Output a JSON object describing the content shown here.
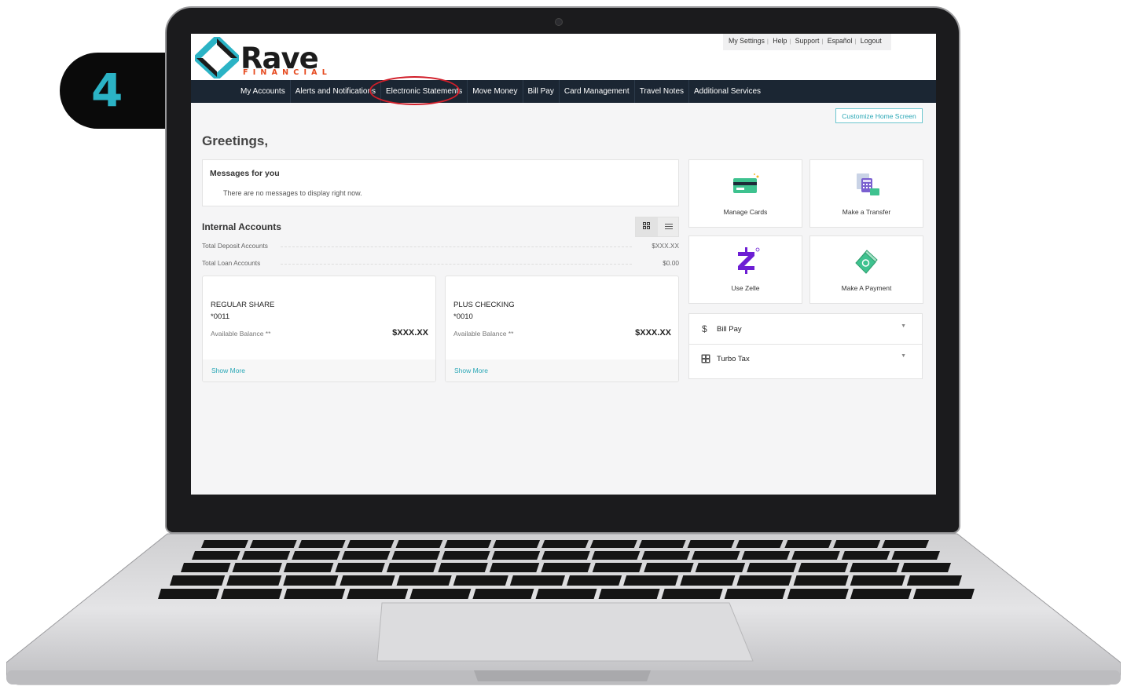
{
  "step": {
    "number": "4"
  },
  "logo": {
    "word": "Rave",
    "sub": "FINANCIAL"
  },
  "utility_links": [
    "My Settings",
    "Help",
    "Support",
    "Español",
    "Logout"
  ],
  "nav": {
    "items": [
      "My Accounts",
      "Alerts and Notifications",
      "Electronic Statements",
      "Move Money",
      "Bill Pay",
      "Card Management",
      "Travel Notes",
      "Additional Services"
    ],
    "highlighted": "Electronic Statements"
  },
  "customize_label": "Customize Home Screen",
  "greeting": "Greetings,",
  "messages": {
    "title": "Messages for you",
    "empty": "There are no messages to display right now."
  },
  "internal_accounts": {
    "title": "Internal Accounts",
    "totals": [
      {
        "label": "Total Deposit Accounts",
        "value": "$XXX.XX"
      },
      {
        "label": "Total Loan Accounts",
        "value": "$0.00"
      }
    ],
    "accounts": [
      {
        "name": "REGULAR SHARE",
        "number": "*0011",
        "balance_label": "Available Balance **",
        "balance": "$XXX.XX",
        "show_more": "Show More"
      },
      {
        "name": "PLUS CHECKING",
        "number": "*0010",
        "balance_label": "Available Balance **",
        "balance": "$XXX.XX",
        "show_more": "Show More"
      }
    ]
  },
  "tiles": [
    {
      "label": "Manage Cards",
      "icon": "credit-card-icon"
    },
    {
      "label": "Make a Transfer",
      "icon": "transfer-icon"
    },
    {
      "label": "Use Zelle",
      "icon": "zelle-icon"
    },
    {
      "label": "Make A Payment",
      "icon": "money-icon"
    }
  ],
  "accordion": [
    {
      "label": "Bill Pay",
      "icon": "dollar-icon"
    },
    {
      "label": "Turbo Tax",
      "icon": "calculator-icon"
    }
  ],
  "colors": {
    "nav_bg": "#1b2633",
    "accent": "#2aa7b6",
    "highlight_ring": "#d11f2a",
    "logo_orange": "#e64a1f",
    "logo_teal": "#2bb3c5",
    "zelle_purple": "#6d1ed4"
  }
}
